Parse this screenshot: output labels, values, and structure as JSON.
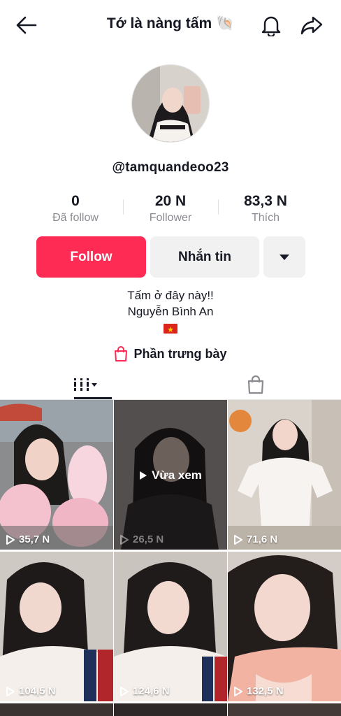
{
  "header": {
    "title": "Tớ là nàng tấm 🐚",
    "icons": [
      "back-arrow-icon",
      "bell-icon",
      "share-icon"
    ]
  },
  "profile": {
    "handle": "@tamquandeoo23",
    "stats": [
      {
        "value": "0",
        "label": "Đã follow"
      },
      {
        "value": "20 N",
        "label": "Follower"
      },
      {
        "value": "83,3 N",
        "label": "Thích"
      }
    ],
    "follow_label": "Follow",
    "message_label": "Nhắn tin",
    "bio_line1": "Tấm ở đây này!!",
    "bio_line2": "Nguyễn Bình An",
    "showcase_label": "Phần trưng bày"
  },
  "colors": {
    "accent": "#fe2c55",
    "text": "#161823",
    "muted": "#8a8b91"
  },
  "videos": [
    {
      "views": "35,7 N"
    },
    {
      "views": "26,5 N",
      "overlay": "Vừa xem"
    },
    {
      "views": "71,6 N"
    },
    {
      "views": "104,5 N"
    },
    {
      "views": "124,6 N"
    },
    {
      "views": "132,5 N"
    }
  ]
}
